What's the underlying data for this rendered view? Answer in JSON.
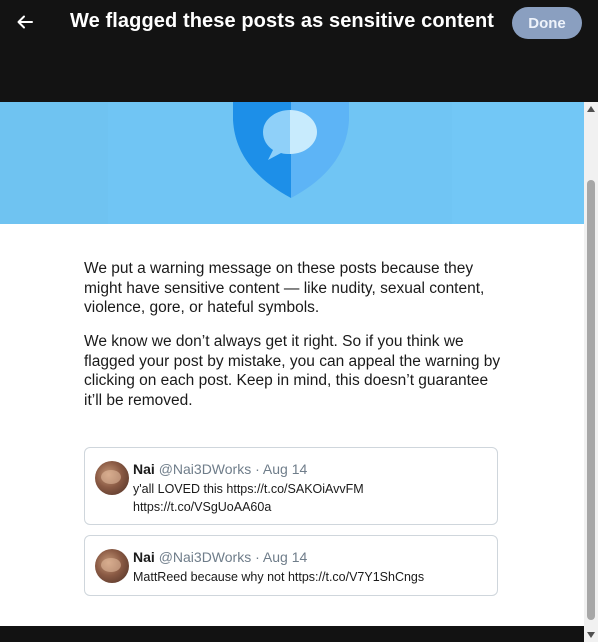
{
  "header": {
    "back_icon": "arrow-left-icon",
    "title": "We flagged these posts as sensitive content",
    "done_label": "Done"
  },
  "banner": {
    "illustration": "shield-speech-bubble-icon",
    "background": "#70c5f4"
  },
  "body": {
    "paragraph1": "We put a warning message on these posts because they might have sensitive content — like nudity, sexual content, violence, gore, or hateful symbols.",
    "paragraph2": "We know we don’t always get it right. So if you think we flagged your post by mistake, you can appeal the warning by clicking on each post. Keep in mind, this doesn’t guarantee it’ll be removed."
  },
  "posts": [
    {
      "name": "Nai",
      "handle": "@Nai3DWorks",
      "separator": "·",
      "date": "Aug 14",
      "text_lines": [
        "y'all LOVED this https://t.co/SAKOiAvvFM",
        "https://t.co/VSgUoAA60a"
      ]
    },
    {
      "name": "Nai",
      "handle": "@Nai3DWorks",
      "separator": "·",
      "date": "Aug 14",
      "text_lines": [
        "MattReed because why not https://t.co/V7Y1ShCngs"
      ]
    }
  ],
  "colors": {
    "header_bg": "#131313",
    "done_button": "#8a9fc0",
    "shield_dark": "#1d8fe8",
    "shield_light": "#5db4f6"
  }
}
